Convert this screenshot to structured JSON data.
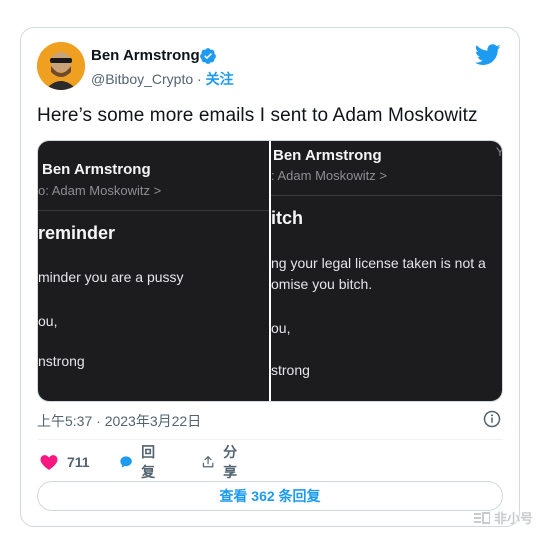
{
  "author": {
    "name": "Ben Armstrong",
    "handle": "@Bitboy_Crypto",
    "separator": " · ",
    "follow_label": "关注",
    "verified": true
  },
  "tweet": {
    "text": "Here’s some more emails I sent to Adam Moskowitz",
    "timestamp": "上午5:37 · 2023年3月22日"
  },
  "media": {
    "left": {
      "sender": "Ben Armstrong",
      "to": "o: Adam Moskowitz >",
      "subject": "reminder",
      "lines": [
        "minder you are a pussy",
        "ou,",
        "nstrong"
      ]
    },
    "right": {
      "sender": "Ben Armstrong",
      "to": ": Adam Moskowitz >",
      "subject": "itch",
      "lines": [
        "ng your legal license taken is not a",
        "omise you bitch.",
        "ou,",
        "strong"
      ],
      "corner": "Y"
    }
  },
  "actions": {
    "like_count": "711",
    "reply_label": "回复",
    "share_label": "分享"
  },
  "replies_button": "查看 362 条回复",
  "watermark": "非小号",
  "colors": {
    "accent": "#1d9bf0",
    "like": "#f91880",
    "text": "#0f1419",
    "muted": "#536471",
    "email_bg": "#1c1c1e"
  }
}
